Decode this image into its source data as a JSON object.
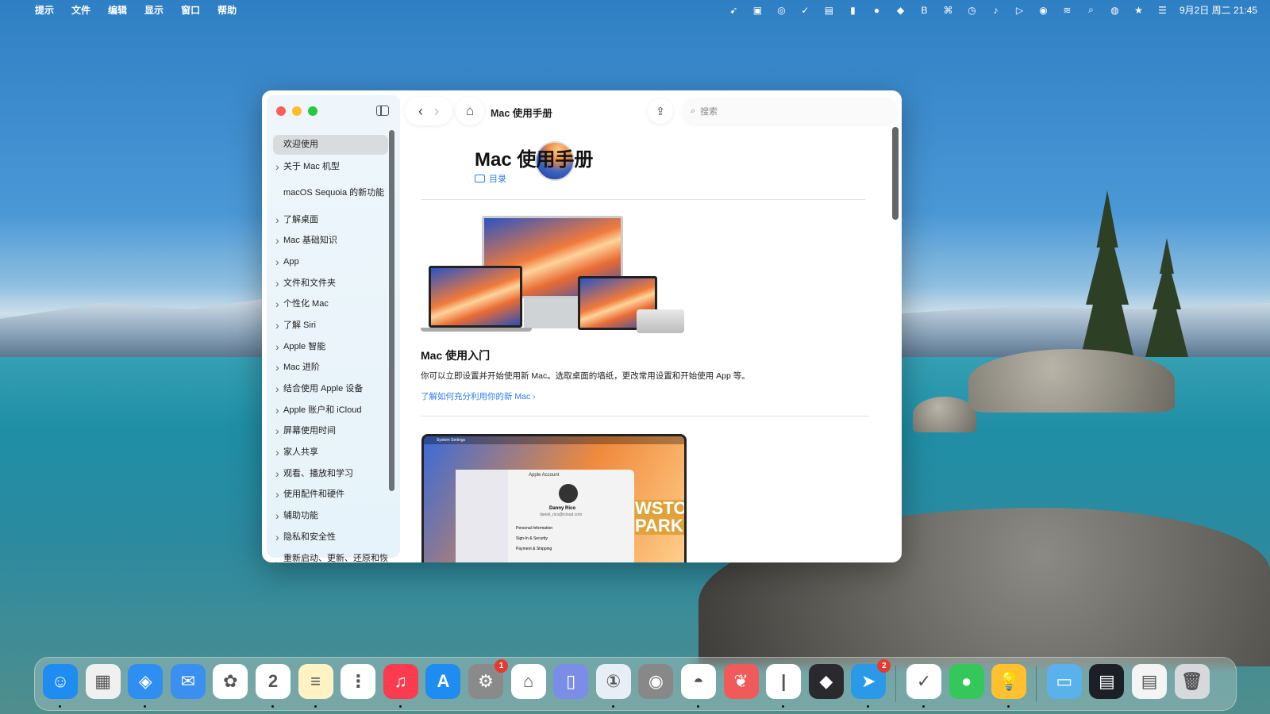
{
  "menubar": {
    "apple": "",
    "items": [
      "提示",
      "文件",
      "编辑",
      "显示",
      "窗口",
      "帮助"
    ],
    "status_icons": [
      "send-icon",
      "display-icon",
      "at-icon",
      "drop-icon",
      "inbox-icon",
      "battery-icon",
      "clock-icon",
      "diamond-icon",
      "b-icon",
      "grid-icon",
      "history-icon",
      "music-icon",
      "play-icon",
      "user-icon",
      "wifi-icon",
      "search-icon",
      "colorball-icon",
      "star-icon",
      "control-center-icon"
    ],
    "datetime": "9月2日 周二 21:45"
  },
  "window": {
    "title": "Mac 使用手册",
    "search_placeholder": "搜索",
    "sidebar": [
      {
        "label": "欢迎使用",
        "selected": true,
        "chevron": false
      },
      {
        "label": "关于 Mac 机型",
        "chevron": true
      },
      {
        "label": "macOS Sequoia 的新功能",
        "chevron": false,
        "tall": true
      },
      {
        "label": "了解桌面",
        "chevron": true
      },
      {
        "label": "Mac 基础知识",
        "chevron": true
      },
      {
        "label": "App",
        "chevron": true
      },
      {
        "label": "文件和文件夹",
        "chevron": true
      },
      {
        "label": "个性化 Mac",
        "chevron": true
      },
      {
        "label": "了解 Siri",
        "chevron": true
      },
      {
        "label": "Apple 智能",
        "chevron": true
      },
      {
        "label": "Mac 进阶",
        "chevron": true
      },
      {
        "label": "结合使用 Apple 设备",
        "chevron": true
      },
      {
        "label": "Apple 账户和 iCloud",
        "chevron": true
      },
      {
        "label": "屏幕使用时间",
        "chevron": true
      },
      {
        "label": "家人共享",
        "chevron": true
      },
      {
        "label": "观看、播放和学习",
        "chevron": true
      },
      {
        "label": "使用配件和硬件",
        "chevron": true
      },
      {
        "label": "辅助功能",
        "chevron": true
      },
      {
        "label": "隐私和安全性",
        "chevron": true
      },
      {
        "label": "重新启动、更新、还原和恢复",
        "chevron": true,
        "tall": true
      }
    ],
    "content": {
      "heading": "Mac 使用手册",
      "toc": "目录",
      "section_title": "Mac 使用入门",
      "section_text": "你可以立即设置并开始使用新 Mac。选取桌面的墙纸，更改常用设置和开始使用 App 等。",
      "section_link": "了解如何充分利用你的新 Mac ›",
      "screenshot": {
        "menu": "System Settings",
        "panel_title": "Apple Account",
        "user": "Danny Rico",
        "email": "daniel_rico@icloud.com",
        "rows": [
          "Personal Information",
          "Sign-In & Security",
          "Payment & Shipping"
        ],
        "poster": "WSTO PARK"
      }
    }
  },
  "dock": [
    {
      "name": "finder",
      "color": "#1e8cf0",
      "glyph": "☺",
      "running": true
    },
    {
      "name": "launchpad",
      "color": "#f0f0f0",
      "glyph": "▦",
      "running": false
    },
    {
      "name": "safari",
      "color": "#2f8ff0",
      "glyph": "◈",
      "running": true
    },
    {
      "name": "mail",
      "color": "#3a8ff0",
      "glyph": "✉",
      "running": false
    },
    {
      "name": "photos",
      "color": "#ffffff",
      "glyph": "✿",
      "running": false
    },
    {
      "name": "calendar",
      "color": "#ffffff",
      "glyph": "2",
      "running": true
    },
    {
      "name": "notes",
      "color": "#fff3c4",
      "glyph": "≡",
      "running": true
    },
    {
      "name": "reminders",
      "color": "#ffffff",
      "glyph": "⋮",
      "running": false
    },
    {
      "name": "music",
      "color": "#fa3b50",
      "glyph": "♫",
      "running": true
    },
    {
      "name": "app-store",
      "color": "#1f8cf2",
      "glyph": "A",
      "running": false
    },
    {
      "name": "system-settings",
      "color": "#8a8a8a",
      "glyph": "⚙",
      "running": false,
      "badge": "1"
    },
    {
      "name": "home",
      "color": "#ffffff",
      "glyph": "⌂",
      "running": false
    },
    {
      "name": "iphone-mirroring",
      "color": "#7a8ee8",
      "glyph": "▯",
      "running": false
    },
    {
      "name": "1password",
      "color": "#e8eef6",
      "glyph": "①",
      "running": true
    },
    {
      "name": "chrome",
      "color": "#888888",
      "glyph": "◉",
      "running": false
    },
    {
      "name": "arc-weather",
      "color": "#ffffff",
      "glyph": "◓",
      "running": true
    },
    {
      "name": "scrobbles",
      "color": "#f05a5a",
      "glyph": "❦",
      "running": false
    },
    {
      "name": "text-editor",
      "color": "#ffffff",
      "glyph": "|",
      "running": true
    },
    {
      "name": "obsidian",
      "color": "#2a2a2e",
      "glyph": "◆",
      "running": false
    },
    {
      "name": "telegram",
      "color": "#2a9ae8",
      "glyph": "➤",
      "running": true,
      "badge": "2"
    },
    {
      "name": "mailmate",
      "color": "#ffffff",
      "glyph": "✓",
      "running": true
    },
    {
      "name": "messages",
      "color": "#34c759",
      "glyph": "●",
      "running": false
    },
    {
      "name": "tips",
      "color": "#ffc22e",
      "glyph": "💡",
      "running": true
    },
    {
      "name": "downloads-folder",
      "color": "#5ab2ec",
      "glyph": "▭",
      "running": false
    },
    {
      "name": "window-preview-telegram",
      "color": "#1c1f26",
      "glyph": "▤",
      "running": false
    },
    {
      "name": "window-preview-browser",
      "color": "#f4f4f4",
      "glyph": "▤",
      "running": false
    },
    {
      "name": "trash",
      "color": "#d6d9dc",
      "glyph": "🗑",
      "running": false
    }
  ],
  "colors": {
    "accent": "#2e7cf6",
    "close": "#ff5f57",
    "minimize": "#febc2e",
    "zoom": "#28c840"
  }
}
